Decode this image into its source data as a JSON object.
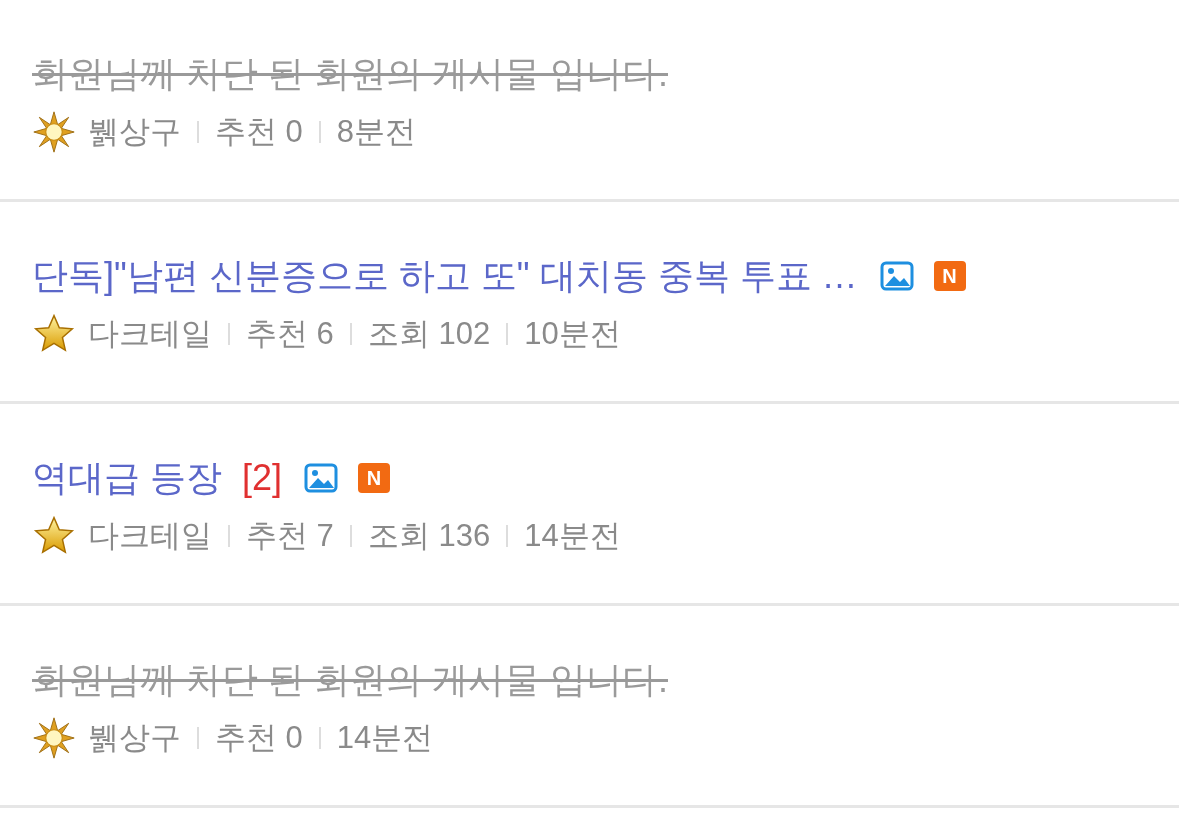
{
  "posts": [
    {
      "blocked": true,
      "title": "회원님께 차단 된 회원의 게시물 입니다.",
      "has_image": false,
      "is_new": false,
      "author": {
        "kind": "sun",
        "name": "뷁상구"
      },
      "stats": [
        "추천 0"
      ],
      "time": "8분전"
    },
    {
      "blocked": false,
      "title": "단독]\"남편 신분증으로 하고 또\" 대치동 중복 투표 …",
      "has_image": true,
      "is_new": true,
      "new_label": "N",
      "author": {
        "kind": "star",
        "name": "다크테일"
      },
      "stats": [
        "추천 6",
        "조회 102"
      ],
      "time": "10분전"
    },
    {
      "blocked": false,
      "title": "역대급 등장",
      "comments": "[2]",
      "has_image": true,
      "is_new": true,
      "new_label": "N",
      "author": {
        "kind": "star",
        "name": "다크테일"
      },
      "stats": [
        "추천 7",
        "조회 136"
      ],
      "time": "14분전"
    },
    {
      "blocked": true,
      "title": "회원님께 차단 된 회원의 게시물 입니다.",
      "has_image": false,
      "is_new": false,
      "author": {
        "kind": "sun",
        "name": "뷁상구"
      },
      "stats": [
        "추천 0"
      ],
      "time": "14분전"
    }
  ]
}
